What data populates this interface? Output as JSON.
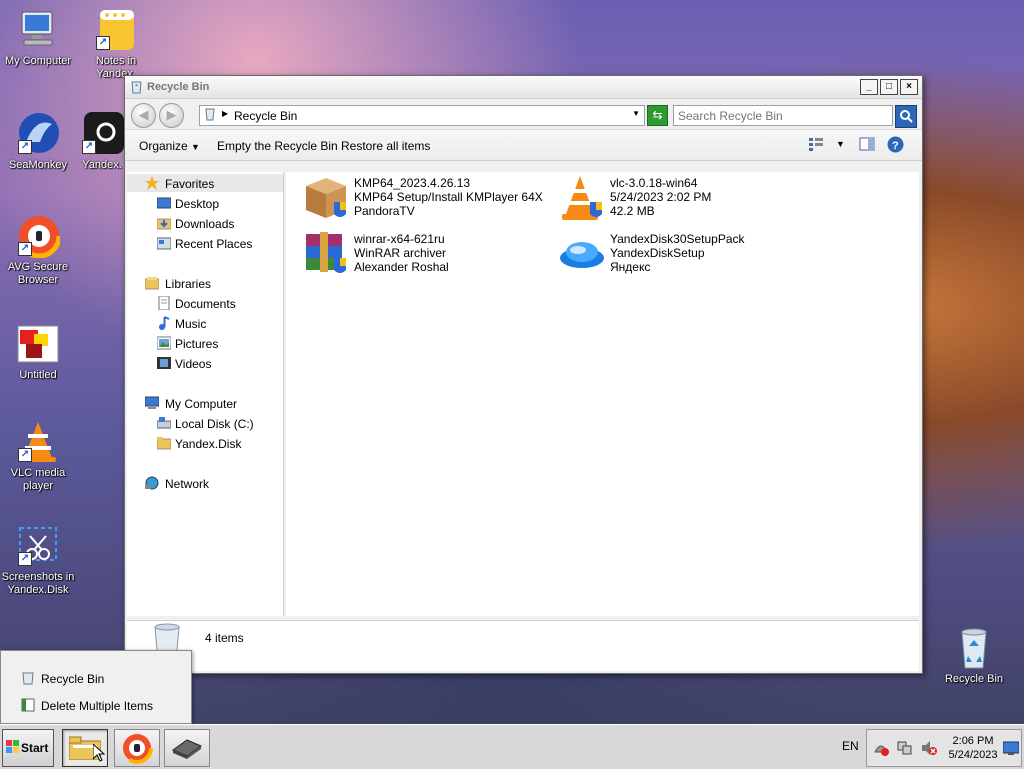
{
  "desktop": {
    "icons": [
      {
        "label": "My Computer"
      },
      {
        "label": "Notes in Yandex."
      },
      {
        "label": "SeaMonkey"
      },
      {
        "label": "Yandex."
      },
      {
        "label": "AVG Secure Browser"
      },
      {
        "label": "Untitled"
      },
      {
        "label": "VLC media player"
      },
      {
        "label": "Screenshots in Yandex.Disk"
      },
      {
        "label": "Recycle Bin"
      }
    ]
  },
  "window": {
    "title": "Recycle Bin",
    "controls": {
      "minimize": "_",
      "maximize": "□",
      "close": "×"
    },
    "address": {
      "path": "Recycle Bin"
    },
    "search": {
      "placeholder": "Search Recycle Bin"
    },
    "toolbar": {
      "organize": "Organize",
      "empty": "Empty the Recycle Bin",
      "restore": "Restore all items"
    },
    "sidebar": {
      "favorites": "Favorites",
      "desktop": "Desktop",
      "downloads": "Downloads",
      "recent": "Recent Places",
      "libraries": "Libraries",
      "documents": "Documents",
      "music": "Music",
      "pictures": "Pictures",
      "videos": "Videos",
      "computer": "My Computer",
      "localdisk": "Local Disk (C:)",
      "yandexdisk": "Yandex.Disk",
      "network": "Network"
    },
    "files": [
      {
        "name": "KMP64_2023.4.26.13",
        "line2": "KMP64 Setup/Install KMPlayer 64X",
        "line3": "PandoraTV"
      },
      {
        "name": "vlc-3.0.18-win64",
        "line2": "5/24/2023 2:02 PM",
        "line3": "42.2 MB"
      },
      {
        "name": "winrar-x64-621ru",
        "line2": "WinRAR archiver",
        "line3": "Alexander Roshal"
      },
      {
        "name": "YandexDisk30SetupPack",
        "line2": "YandexDiskSetup",
        "line3": "Яндекс"
      }
    ],
    "status": {
      "count": "4 items"
    }
  },
  "jumplist": {
    "items": [
      {
        "label": "Recycle Bin"
      },
      {
        "label": "Delete Multiple Items"
      }
    ]
  },
  "taskbar": {
    "start": "Start",
    "language": "EN",
    "time": "2:06 PM",
    "date": "5/24/2023"
  }
}
